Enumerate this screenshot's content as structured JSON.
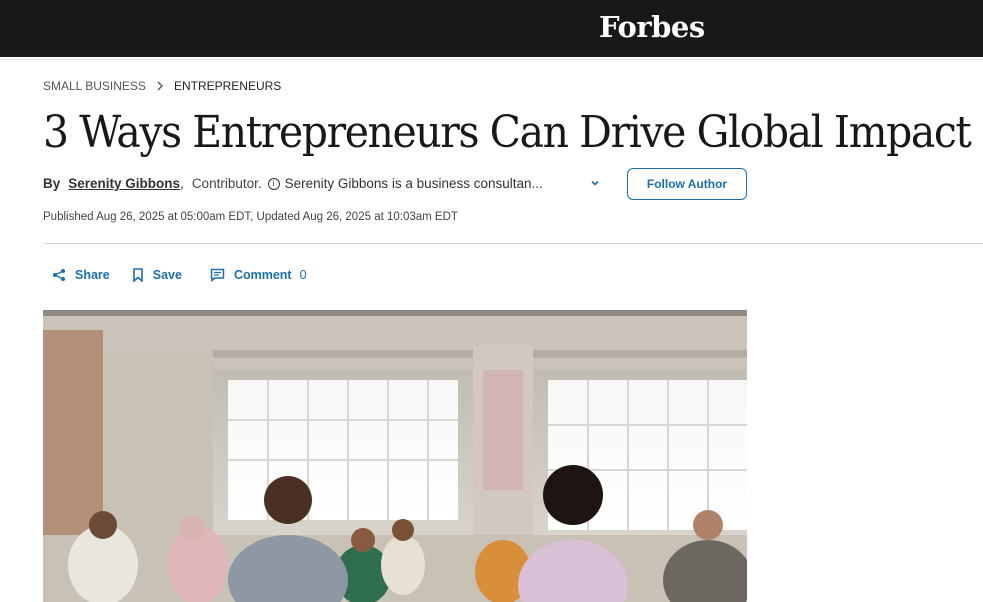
{
  "header": {
    "logo": "Forbes"
  },
  "breadcrumb": {
    "section": "SMALL BUSINESS",
    "subsection": "ENTREPRENEURS"
  },
  "article": {
    "title": "3 Ways Entrepreneurs Can Drive Global Impact",
    "by_label": "By",
    "author": "Serenity Gibbons",
    "role": "Contributor.",
    "bio": "Serenity Gibbons is a business consultan...",
    "follow_label": "Follow Author",
    "published": "Published Aug 26, 2025 at 05:00am EDT, Updated Aug 26, 2025 at 10:03am EDT"
  },
  "actions": {
    "share": "Share",
    "save": "Save",
    "comment": "Comment",
    "comment_count": "0"
  },
  "colors": {
    "topbar": "#181818",
    "link_blue": "#1a6fb0"
  },
  "icons": [
    "share-icon",
    "bookmark-icon",
    "comment-icon",
    "info-icon",
    "chevron-down-icon"
  ]
}
